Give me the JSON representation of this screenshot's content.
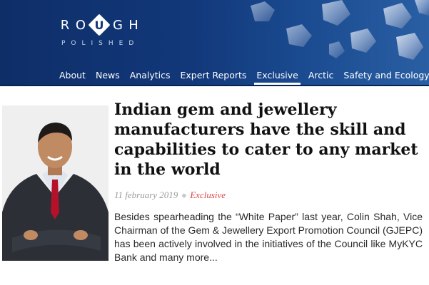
{
  "logo": {
    "letters": [
      "R",
      "O",
      "U",
      "G",
      "H"
    ],
    "subtitle": "POLISHED"
  },
  "nav": {
    "items": [
      {
        "label": "About",
        "active": false
      },
      {
        "label": "News",
        "active": false
      },
      {
        "label": "Analytics",
        "active": false
      },
      {
        "label": "Expert Reports",
        "active": false
      },
      {
        "label": "Exclusive",
        "active": true
      },
      {
        "label": "Arctic",
        "active": false
      },
      {
        "label": "Safety and Ecology",
        "active": false
      }
    ]
  },
  "article": {
    "title": "Indian gem and jewellery manufacturers have the skill and capabilities to cater to any market in the world",
    "date": "11 february 2019",
    "category": "Exclusive",
    "excerpt": "Besides spearheading the “White Paper” last year, Colin Shah, Vice Chairman of the Gem & Jewellery Export Promotion Council (GJEPC) has been actively involved in the initiatives of the Council like MyKYC Bank and many more..."
  },
  "colors": {
    "banner": "#12387a",
    "category_accent": "#e0444d",
    "date": "#9a9a9a"
  }
}
